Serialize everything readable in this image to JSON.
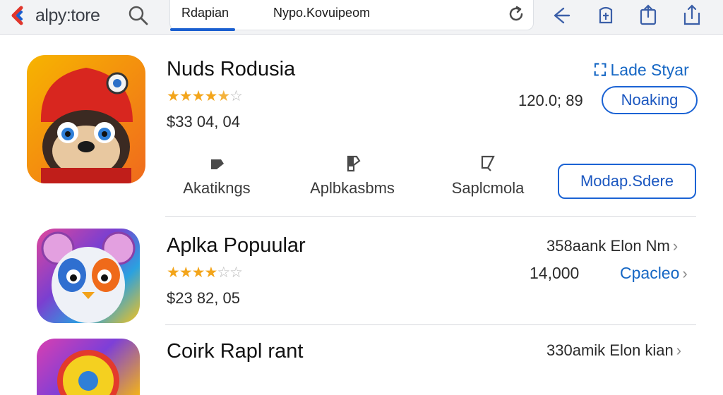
{
  "toolbar": {
    "logo_text": "alpy:tore",
    "tabs": [
      {
        "label": "Rdapian",
        "active": true
      },
      {
        "label": "Nypo.Kovuipeom",
        "active": false
      }
    ],
    "icons": [
      "search-icon",
      "reload-icon",
      "back-icon",
      "share-icon",
      "upload-icon",
      "export-icon"
    ]
  },
  "apps": [
    {
      "title": "Nuds Rodusia",
      "stars_filled": 4.5,
      "stars_total": 5,
      "price": "$33 04, 04",
      "right_link": "Lade Styar",
      "right_value": "120.0; 89",
      "primary_button": "Noaking",
      "actions": [
        {
          "label": "Akatikngs",
          "icon": "tag-icon"
        },
        {
          "label": "Aplbkasbms",
          "icon": "bookmark-icon"
        },
        {
          "label": "Saplcmola",
          "icon": "edit-icon"
        }
      ],
      "secondary_button": "Modap.Sdere"
    },
    {
      "title": "Aplka Popuular",
      "stars_filled": 4,
      "stars_total": 5,
      "price": "$23 82, 05",
      "right_label": "358aank Elon Nm",
      "right_value": "14,000",
      "right_link": "Cpacleo"
    },
    {
      "title": "Coirk Rapl rant",
      "right_label": "330amik Elon kian"
    }
  ],
  "colors": {
    "accent": "#1b63d4",
    "star": "#f3a51b",
    "topbar": "#f2f3f5"
  }
}
